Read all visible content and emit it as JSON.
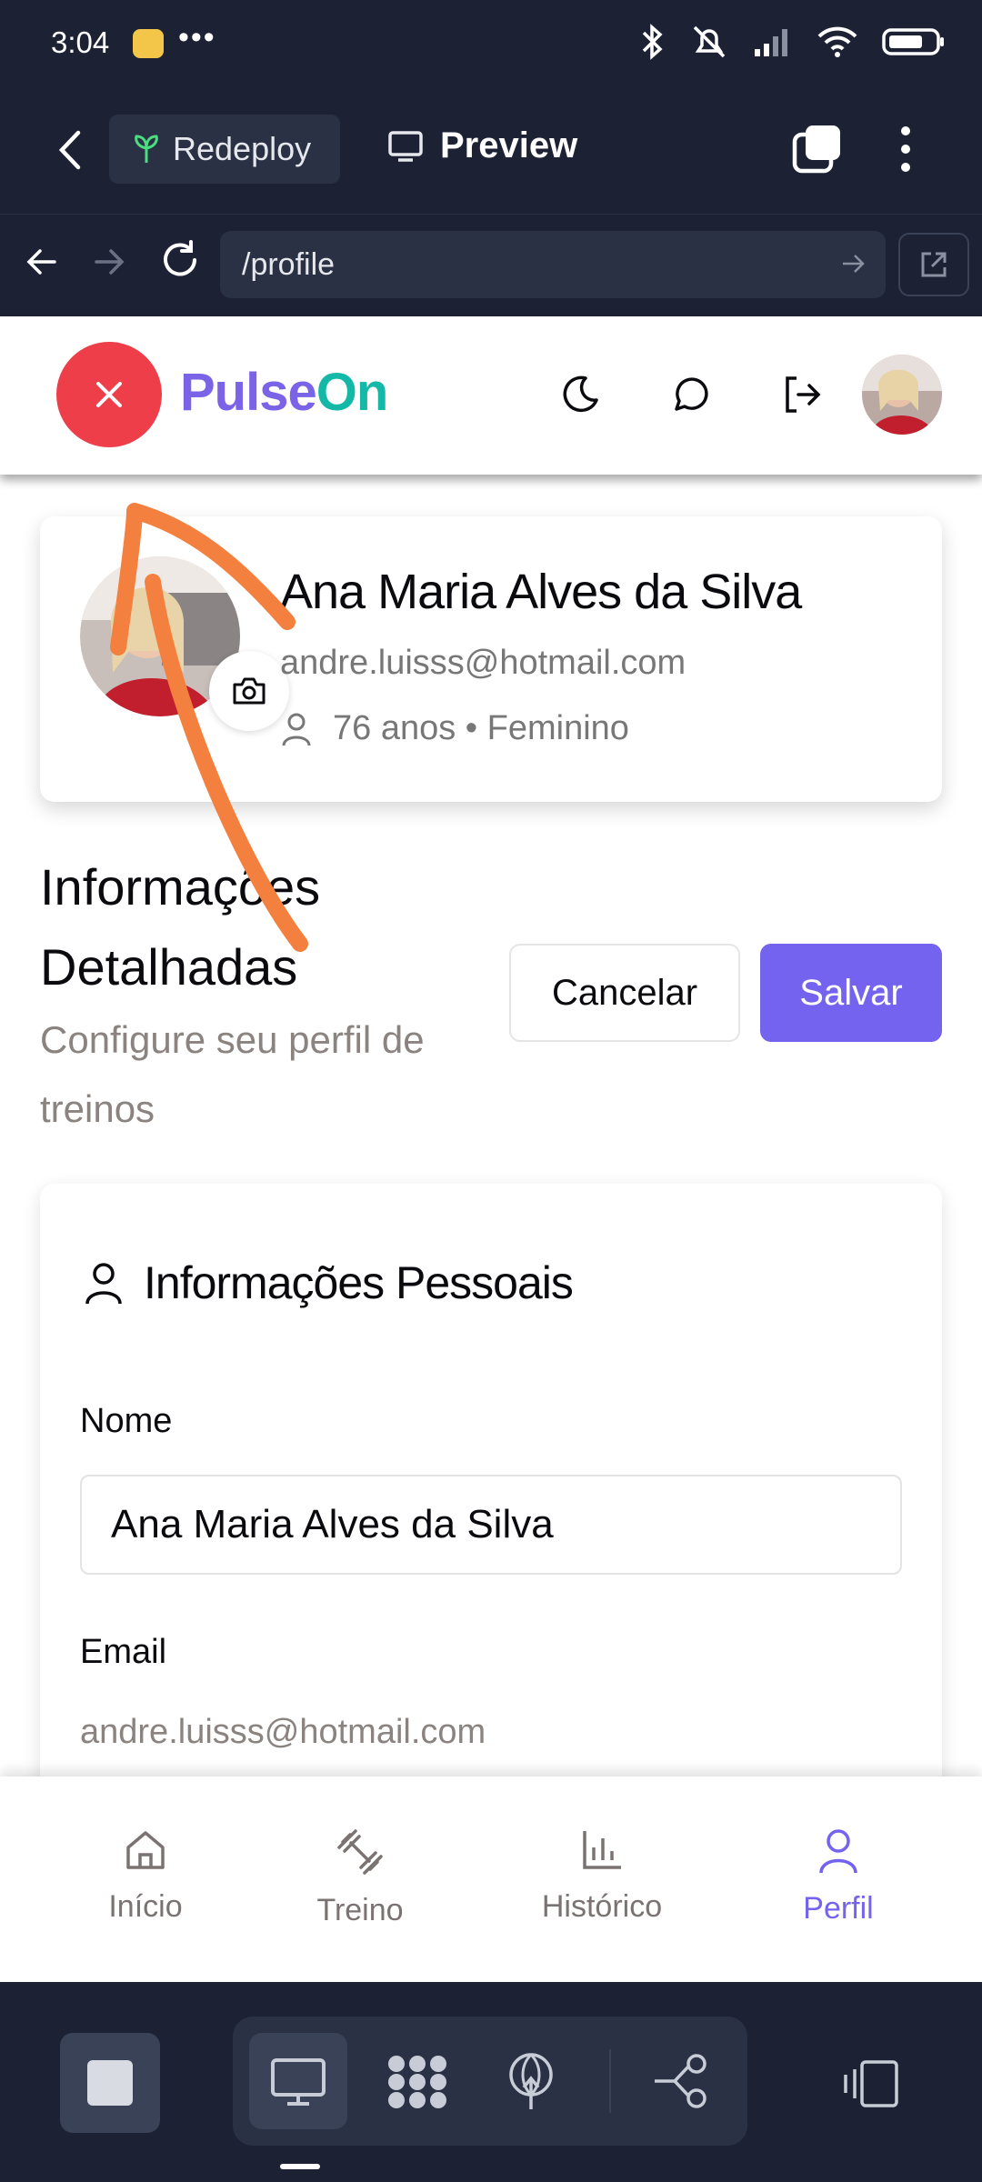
{
  "status_bar": {
    "time": "3:04",
    "dots": "•••"
  },
  "browser": {
    "redeploy_label": "Redeploy",
    "preview_label": "Preview",
    "url": "/profile"
  },
  "header": {
    "brand_part1": "Pulse",
    "brand_part2": "On"
  },
  "profile": {
    "name": "Ana Maria Alves da Silva",
    "email": "andre.luisss@hotmail.com",
    "meta": "76 anos • Feminino"
  },
  "details": {
    "title": "Informações Detalhadas",
    "subtitle": "Configure seu perfil de treinos",
    "cancel_label": "Cancelar",
    "save_label": "Salvar"
  },
  "personal_info": {
    "title": "Informações Pessoais",
    "name_label": "Nome",
    "name_value": "Ana Maria Alves da Silva",
    "email_label": "Email",
    "email_value": "andre.luisss@hotmail.com"
  },
  "bottom_nav": {
    "items": [
      {
        "label": "Início",
        "icon": "home-icon"
      },
      {
        "label": "Treino",
        "icon": "dumbbell-icon"
      },
      {
        "label": "Histórico",
        "icon": "bar-chart-icon"
      },
      {
        "label": "Perfil",
        "icon": "user-icon",
        "active": true
      }
    ]
  },
  "colors": {
    "brand_purple": "#7b63e8",
    "brand_teal": "#14b8a6",
    "close_red": "#ee3e4a",
    "primary_button": "#7463ee",
    "chrome_dark": "#1c2233",
    "annotation_orange": "#f4803f"
  }
}
